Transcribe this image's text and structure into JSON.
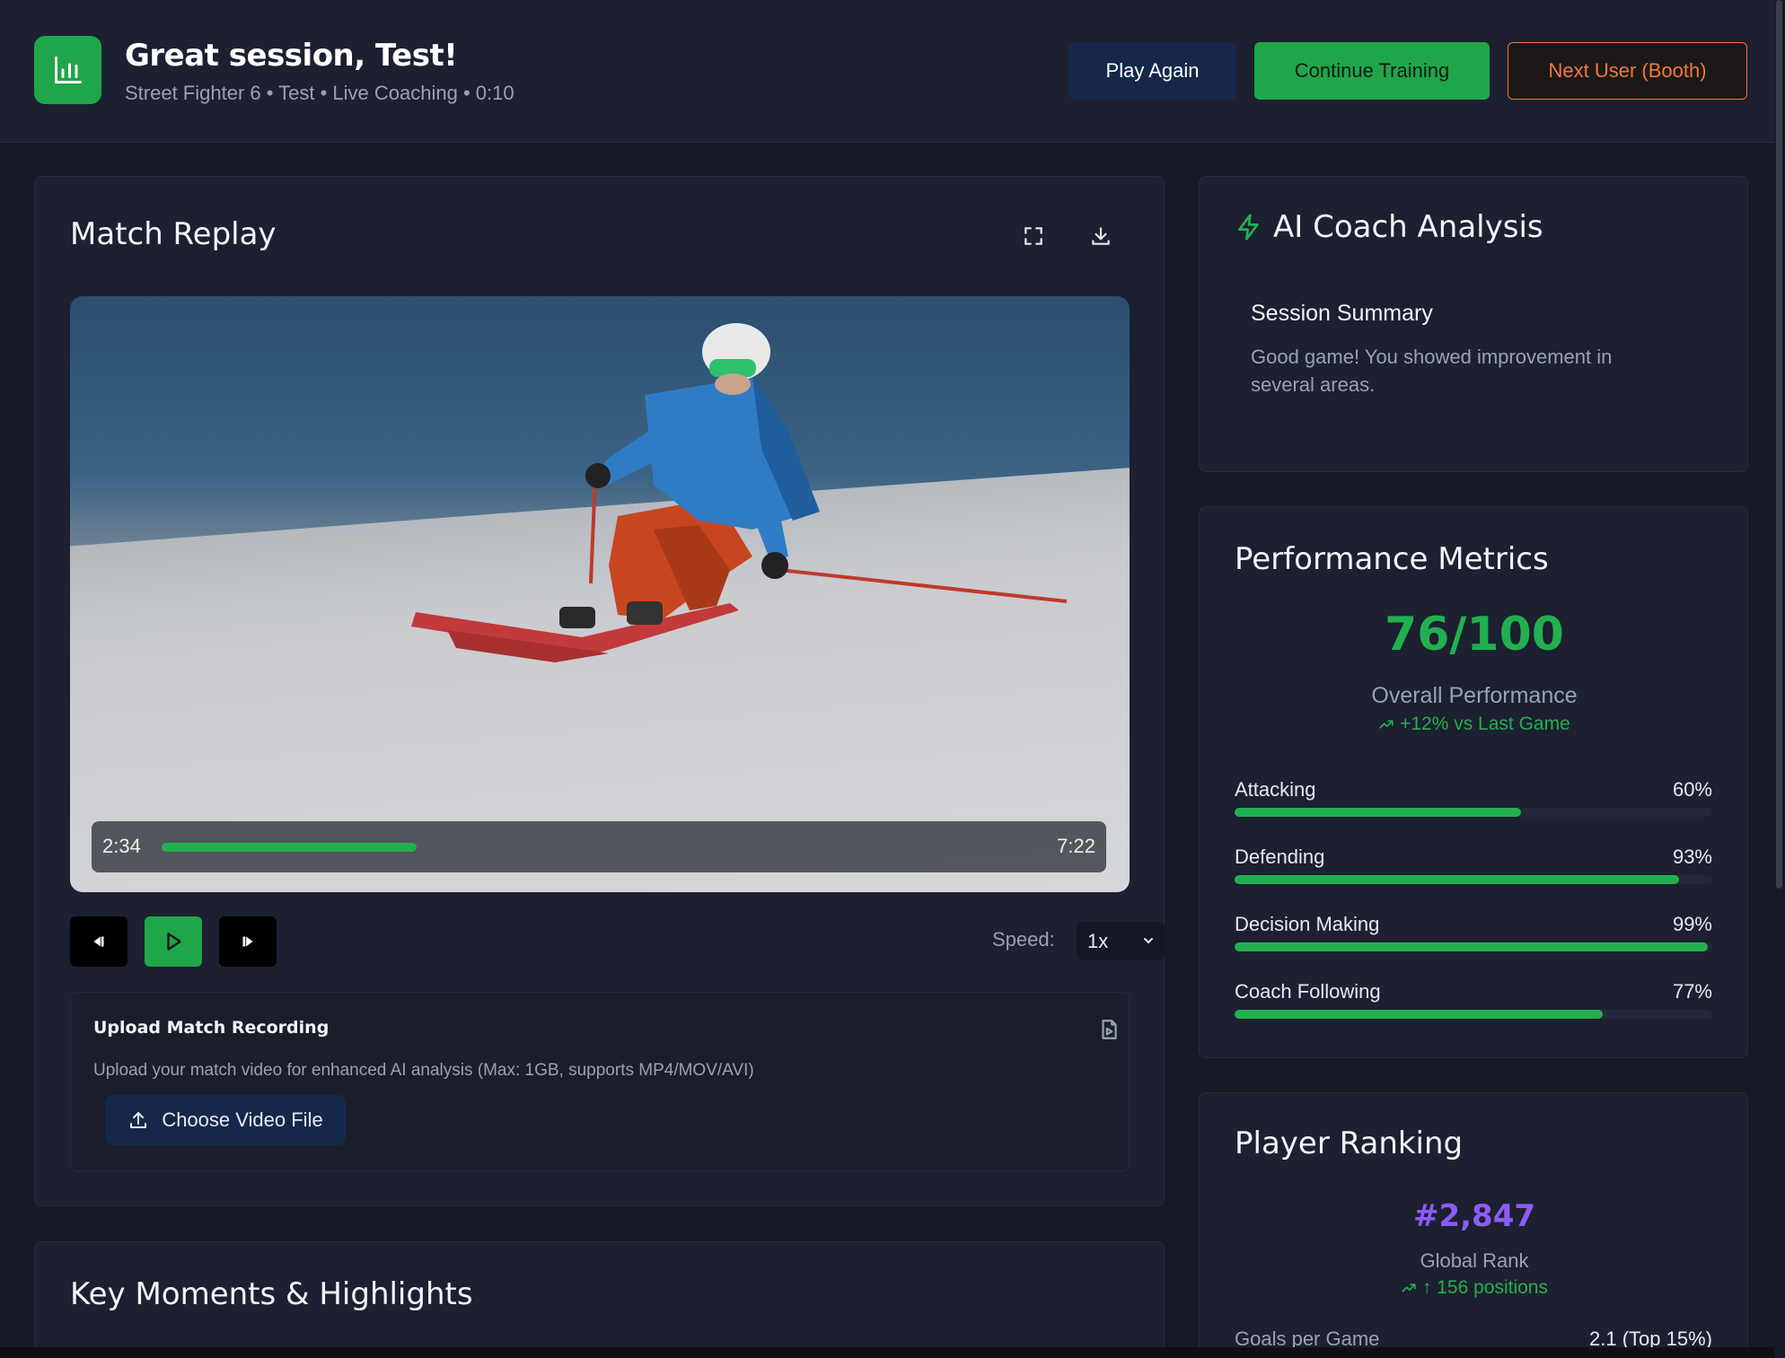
{
  "header": {
    "title": "Great session, Test!",
    "subtitle": "Street Fighter 6 • Test • Live Coaching • 0:10",
    "play_again": "Play Again",
    "continue_training": "Continue Training",
    "next_user": "Next User (Booth)"
  },
  "replay": {
    "title": "Match Replay",
    "current_time": "2:34",
    "total_time": "7:22",
    "progress": 0.35,
    "speed_label": "Speed:",
    "speed_value": "1x"
  },
  "upload": {
    "title": "Upload Match Recording",
    "description": "Upload your match video for enhanced AI analysis (Max: 1GB, supports MP4/MOV/AVI)",
    "button": "Choose Video File"
  },
  "highlights": {
    "title": "Key Moments & Highlights"
  },
  "coach": {
    "title": "AI Coach Analysis",
    "summary_title": "Session Summary",
    "summary_text": "Good game! You showed improvement in several areas."
  },
  "performance": {
    "title": "Performance Metrics",
    "score": "76/100",
    "score_label": "Overall Performance",
    "trend": "+12% vs Last Game",
    "metrics": [
      {
        "label": "Attacking",
        "value": "60%",
        "fraction": 0.6
      },
      {
        "label": "Defending",
        "value": "93%",
        "fraction": 0.93
      },
      {
        "label": "Decision Making",
        "value": "99%",
        "fraction": 0.99
      },
      {
        "label": "Coach Following",
        "value": "77%",
        "fraction": 0.77
      }
    ]
  },
  "ranking": {
    "title": "Player Ranking",
    "rank": "#2,847",
    "rank_label": "Global Rank",
    "trend": "↑ 156 positions",
    "goals_label": "Goals per Game",
    "goals_value": "2.1 (Top 15%)"
  },
  "colors": {
    "accent_green": "#22b04f",
    "accent_orange": "#f07a3c",
    "rank_purple": "#8b5cf6"
  }
}
